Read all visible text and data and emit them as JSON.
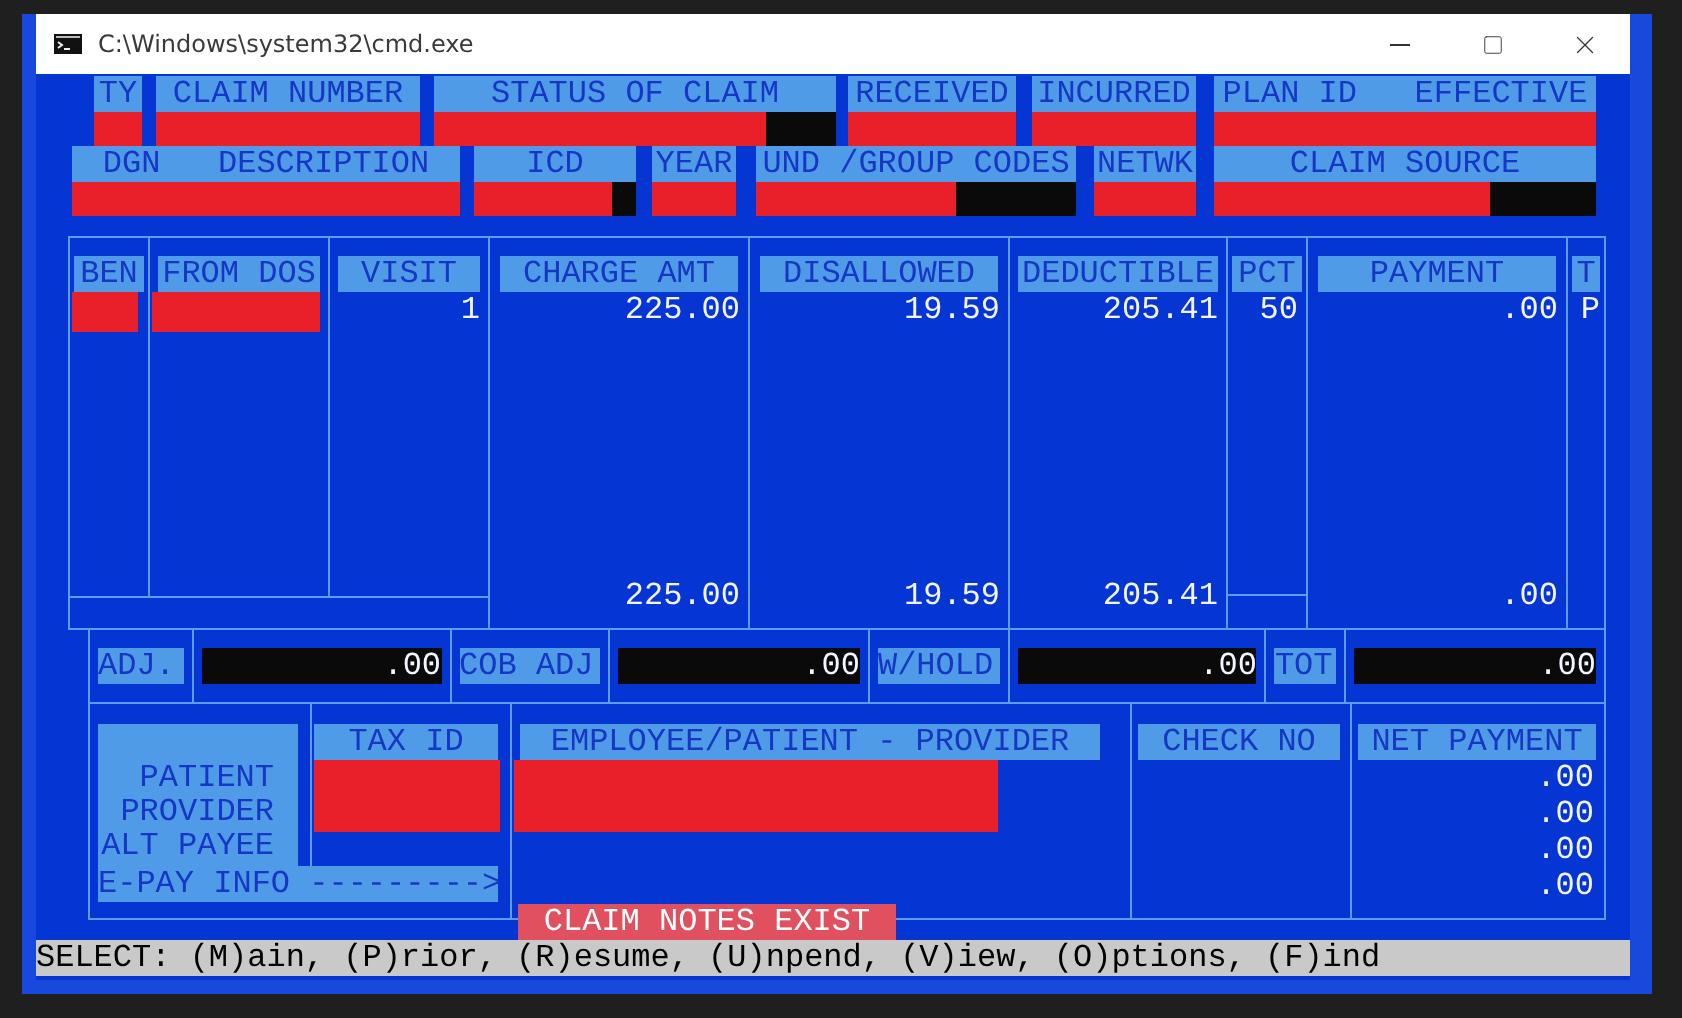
{
  "window": {
    "title": "C:\\Windows\\system32\\cmd.exe"
  },
  "claim_fields": {
    "line_1": [
      {
        "label": "TY",
        "redacted": true
      },
      {
        "label": "CLAIM NUMBER",
        "redacted": true
      },
      {
        "label": "STATUS OF CLAIM",
        "redacted": true
      },
      {
        "label": "RECEIVED",
        "redacted": true
      },
      {
        "label": "INCURRED",
        "redacted": true
      },
      {
        "label": "PLAN ID   EFFECTIVE",
        "redacted": true
      }
    ],
    "line_2": [
      {
        "label": "DGN   DESCRIPTION",
        "redacted": true
      },
      {
        "label": "ICD",
        "redacted": true
      },
      {
        "label": "YEAR",
        "redacted": true
      },
      {
        "label": "UND /GROUP CODES",
        "redacted": true
      },
      {
        "label": "NETWK",
        "redacted": true
      },
      {
        "label": "CLAIM SOURCE",
        "redacted": true
      }
    ]
  },
  "lines": {
    "columns": [
      "BEN",
      "FROM DOS",
      "VISIT",
      "CHARGE AMT",
      "DISALLOWED",
      "DEDUCTIBLE",
      "PCT",
      "PAYMENT",
      "T"
    ],
    "rows": [
      {
        "cells": [
          {
            "redacted": true
          },
          {
            "redacted": true
          },
          {
            "redacted": false,
            "text": "1"
          },
          {
            "redacted": false,
            "text": "225.00"
          },
          {
            "redacted": false,
            "text": "19.59"
          },
          {
            "redacted": false,
            "text": "205.41"
          },
          {
            "redacted": false,
            "text": "50"
          },
          {
            "redacted": false,
            "text": ".00"
          },
          {
            "redacted": false,
            "text": "P"
          }
        ]
      }
    ],
    "totals": {
      "column_4": "225.00",
      "column_5": "19.59",
      "column_6": "205.41",
      "column_8": ".00"
    }
  },
  "adjustments": [
    {
      "label": "ADJ.",
      "value": ".00"
    },
    {
      "label": "COB ADJ",
      "value": ".00"
    },
    {
      "label": "W/HOLD",
      "value": ".00"
    },
    {
      "label": "TOT",
      "value": ".00"
    }
  ],
  "payees": {
    "roles": [
      "PATIENT",
      "PROVIDER",
      "ALT PAYEE"
    ],
    "epay": "E-PAY INFO --------->",
    "columns": [
      {
        "label": "TAX ID",
        "redacted": true
      },
      {
        "label": "EMPLOYEE/PATIENT - PROVIDER",
        "redacted": true
      },
      {
        "label": "CHECK NO",
        "redacted": false
      },
      {
        "label": "NET PAYMENT",
        "redacted": false,
        "values": [
          ".00",
          ".00",
          ".00",
          ".00"
        ]
      }
    ]
  },
  "notice": "CLAIM NOTES EXIST",
  "status_bar": "SELECT: (M)ain, (P)rior, (R)esume, (U)npend, (V)iew, (O)ptions, (F)ind"
}
